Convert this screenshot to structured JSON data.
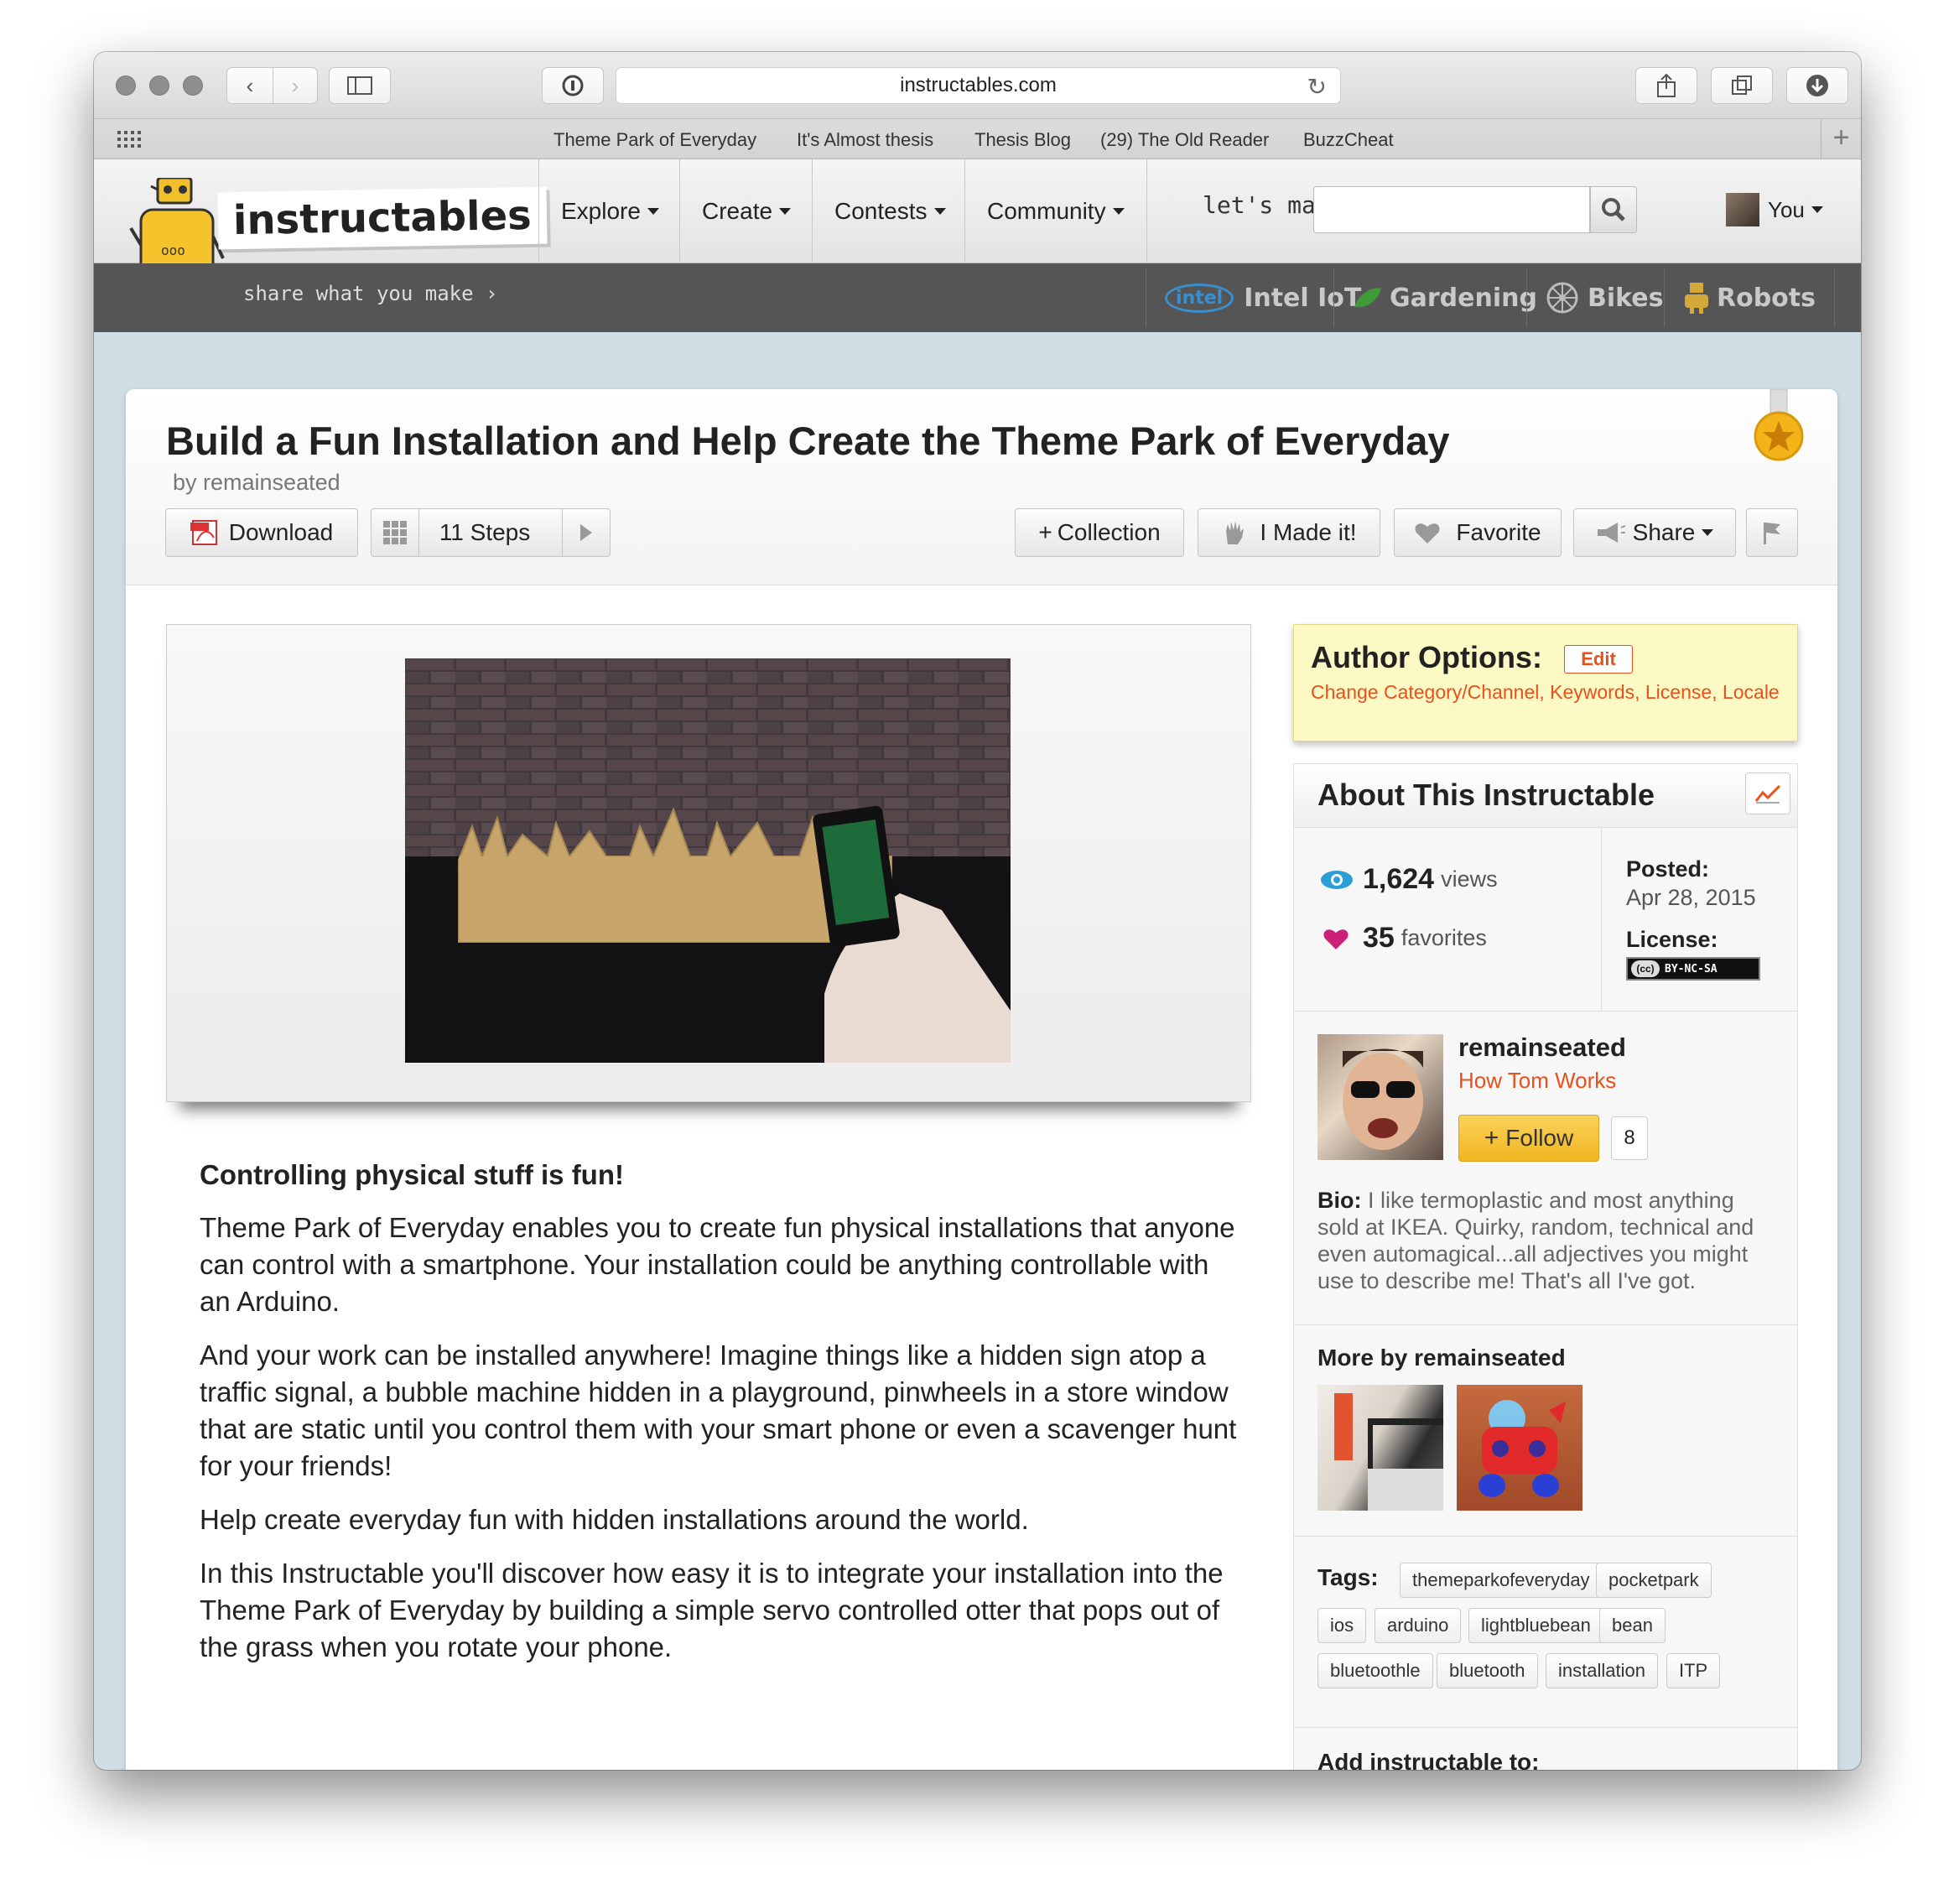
{
  "browser": {
    "url": "instructables.com",
    "bookmarks": [
      "Theme Park of Everyday",
      "It's Almost thesis",
      "Thesis Blog",
      "(29) The Old Reader",
      "BuzzCheat"
    ]
  },
  "site": {
    "logo_text": "instructables",
    "tagline": "share what you make",
    "nav": [
      "Explore",
      "Create",
      "Contests",
      "Community"
    ],
    "search_label": "let's make",
    "search_placeholder": "",
    "user_label": "You",
    "channels": [
      "Intel IoT",
      "Gardening",
      "Bikes",
      "Robots"
    ],
    "intel_badge": "intel"
  },
  "article": {
    "title": "Build a Fun Installation and Help Create the Theme Park of Everyday",
    "byline": "by remainseated",
    "download_label": "Download",
    "steps_label": "11 Steps",
    "collection_label": "Collection",
    "made_it_label": "I Made it!",
    "favorite_label": "Favorite",
    "share_label": "Share",
    "heading": "Controlling physical stuff is fun!",
    "paragraphs": [
      "Theme Park of Everyday enables you to create fun physical installations that anyone can control with a smartphone. Your installation could be anything controllable with an Arduino.",
      "And your work can be installed anywhere! Imagine things like a hidden sign atop a traffic signal, a bubble machine hidden in a playground, pinwheels in a store window that are static until you control them with your smart phone or even a scavenger hunt for your friends!",
      "Help create everyday fun with hidden installations around the world.",
      "In this Instructable you'll discover how easy it is to integrate your installation into the Theme Park of Everyday by building a simple servo controlled otter that pops out of the grass when you rotate your phone."
    ]
  },
  "sidebar": {
    "author_options_title": "Author Options:",
    "edit_label": "Edit",
    "author_links": "Change Category/Channel, Keywords, License, Locale",
    "about_title": "About This Instructable",
    "views_count": "1,624",
    "views_label": "views",
    "favorites_count": "35",
    "favorites_label": "favorites",
    "posted_label": "Posted:",
    "posted_date": "Apr 28, 2015",
    "license_label": "License:",
    "license_badge": "BY-NC-SA",
    "author_name": "remainseated",
    "author_link": "How Tom Works",
    "follow_label": "Follow",
    "follow_count": "8",
    "bio_label": "Bio:",
    "bio_text": "I like termoplastic and most anything sold at IKEA. Quirky, random, technical and even automagical...all adjectives you might use to describe me! That's all I've got.",
    "more_by": "More by remainseated",
    "tags_label": "Tags:",
    "tags": [
      "themeparkofeveryday",
      "pocketpark",
      "ios",
      "arduino",
      "lightbluebean",
      "bean",
      "bluetoothle",
      "bluetooth",
      "installation",
      "ITP"
    ],
    "add_to": "Add instructable to:"
  },
  "colors": {
    "accent_orange": "#e8501c",
    "follow_yellow": "#f7c531",
    "views_blue": "#2a9fd6",
    "fav_pink": "#cc1f7a"
  }
}
